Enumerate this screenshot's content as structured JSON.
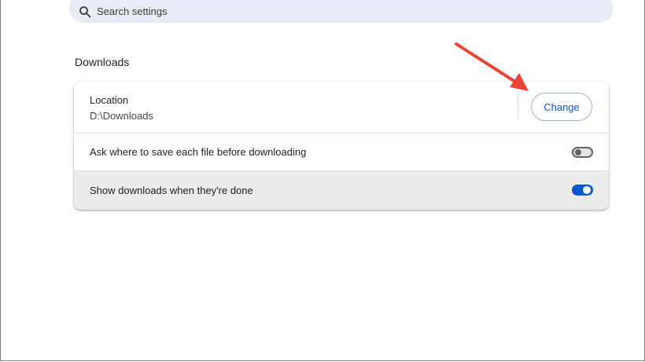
{
  "search": {
    "placeholder": "Search settings",
    "icon": "search-icon"
  },
  "downloads": {
    "section_title": "Downloads",
    "location": {
      "label": "Location",
      "value": "D:\\Downloads",
      "change_label": "Change"
    },
    "ask_where": {
      "label": "Ask where to save each file before downloading",
      "enabled": false
    },
    "show_downloads": {
      "label": "Show downloads when they're done",
      "enabled": true
    }
  },
  "colors": {
    "accent": "#0b57d0",
    "annotation_arrow": "#ea4335",
    "search_bg": "#e8ecf6"
  }
}
